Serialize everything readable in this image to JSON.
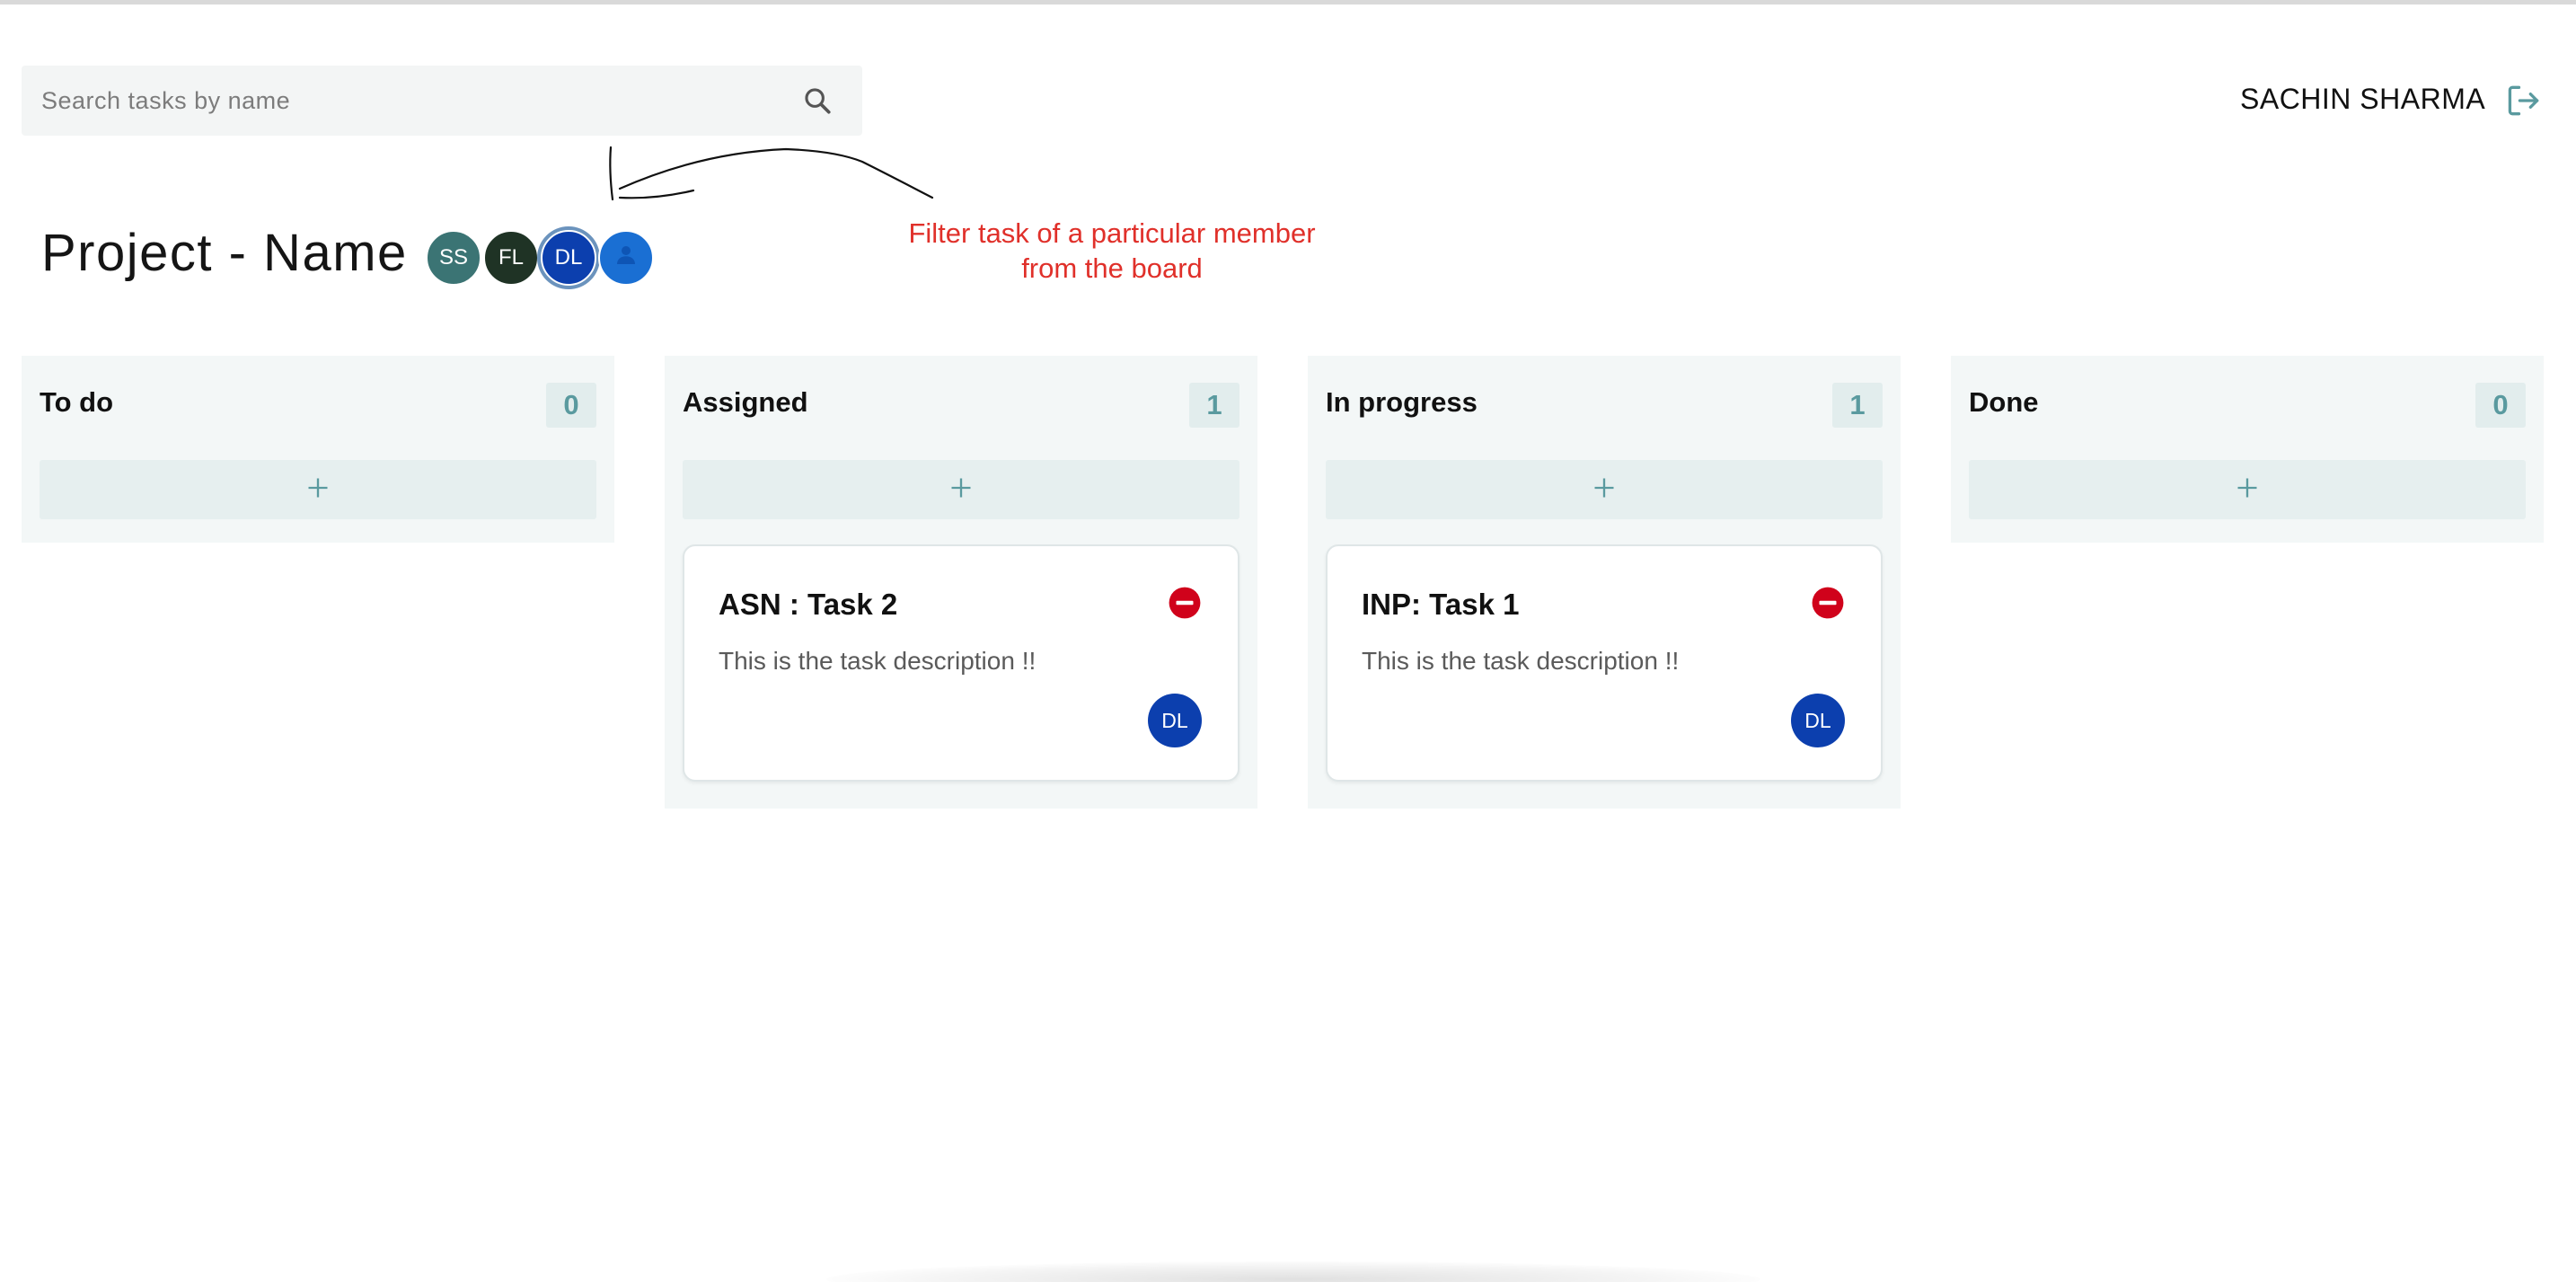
{
  "search": {
    "placeholder": "Search tasks by name",
    "value": ""
  },
  "user": {
    "name": "SACHIN SHARMA"
  },
  "project": {
    "title": "Project - Name",
    "members": [
      {
        "initials": "SS",
        "color": "#3b7474"
      },
      {
        "initials": "FL",
        "color": "#1f3325"
      },
      {
        "initials": "DL",
        "color": "#0c3fae",
        "selected": true
      },
      {
        "initials": "",
        "color": "#1a6fd3",
        "icon": "person-icon"
      }
    ]
  },
  "annotation": {
    "text": "Filter task of a particular member\nfrom the board",
    "color": "#e0302a"
  },
  "columns": [
    {
      "title": "To do",
      "count": "0",
      "add_label": "+",
      "tasks": []
    },
    {
      "title": "Assigned",
      "count": "1",
      "add_label": "+",
      "tasks": [
        {
          "title": "ASN : Task 2",
          "description": "This is the task description !!",
          "assignee": "DL"
        }
      ]
    },
    {
      "title": "In progress",
      "count": "1",
      "add_label": "+",
      "tasks": [
        {
          "title": "INP: Task 1",
          "description": "This is the task description !!",
          "assignee": "DL"
        }
      ]
    },
    {
      "title": "Done",
      "count": "0",
      "add_label": "+",
      "tasks": []
    }
  ],
  "colors": {
    "accent": "#5a9a9f",
    "column_bg": "#f3f7f7",
    "delete": "#d0021b",
    "avatar_blue": "#0c3fae"
  }
}
